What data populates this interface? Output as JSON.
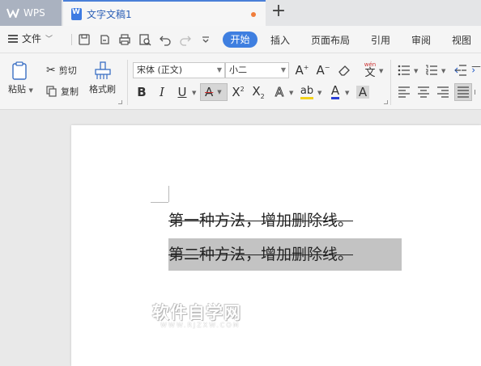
{
  "titlebar": {
    "app_tab": "WPS",
    "doc_tab": "文字文稿1",
    "new_tab_symbol": "+"
  },
  "menubar": {
    "file_label": "文件",
    "tabs": [
      "开始",
      "插入",
      "页面布局",
      "引用",
      "审阅",
      "视图"
    ],
    "active_tab": "开始",
    "accent_color": "#3f7fe0"
  },
  "ribbon": {
    "paste_label": "粘贴",
    "cut_label": "剪切",
    "copy_label": "复制",
    "format_painter_label": "格式刷",
    "font_name": "宋体 (正文)",
    "font_size": "小二",
    "phonetic_label": "wén"
  },
  "document": {
    "lines": [
      "第一种方法，增加删除线。",
      "第二种方法，增加删除线。"
    ],
    "watermark_main": "软件自学网",
    "watermark_sub": "WWW.RJZXW.COM"
  }
}
